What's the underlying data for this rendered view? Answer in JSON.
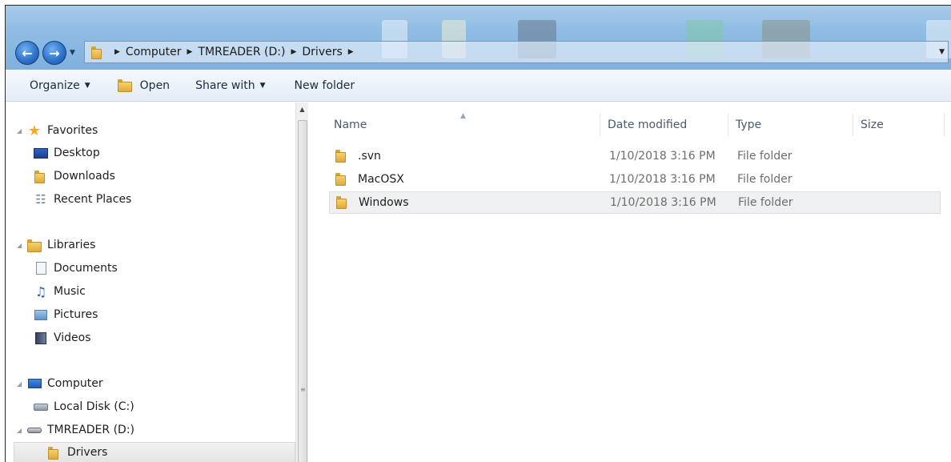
{
  "address": {
    "crumbs": [
      "Computer",
      "TMREADER (D:)",
      "Drivers"
    ]
  },
  "toolbar": {
    "organize": "Organize",
    "open": "Open",
    "share_with": "Share with",
    "new_folder": "New folder"
  },
  "navigation": {
    "favorites": "Favorites",
    "desktop": "Desktop",
    "downloads": "Downloads",
    "recent_places": "Recent Places",
    "libraries": "Libraries",
    "documents": "Documents",
    "music": "Music",
    "pictures": "Pictures",
    "videos": "Videos",
    "computer": "Computer",
    "local_disk": "Local Disk (C:)",
    "tmreader": "TMREADER (D:)",
    "drivers": "Drivers"
  },
  "columns": {
    "name": "Name",
    "date_modified": "Date modified",
    "type": "Type",
    "size": "Size"
  },
  "files": [
    {
      "name": ".svn",
      "date": "1/10/2018 3:16 PM",
      "type": "File folder"
    },
    {
      "name": "MacOSX",
      "date": "1/10/2018 3:16 PM",
      "type": "File folder"
    },
    {
      "name": "Windows",
      "date": "1/10/2018 3:16 PM",
      "type": "File folder"
    }
  ],
  "icons": {
    "back": "back-arrow-icon",
    "forward": "forward-arrow-icon",
    "folder": "folder-icon"
  },
  "colors": {
    "selection": "#eff0f1",
    "toolbar_top": "#f5f9fd",
    "title_accent": "#8fbce3"
  }
}
